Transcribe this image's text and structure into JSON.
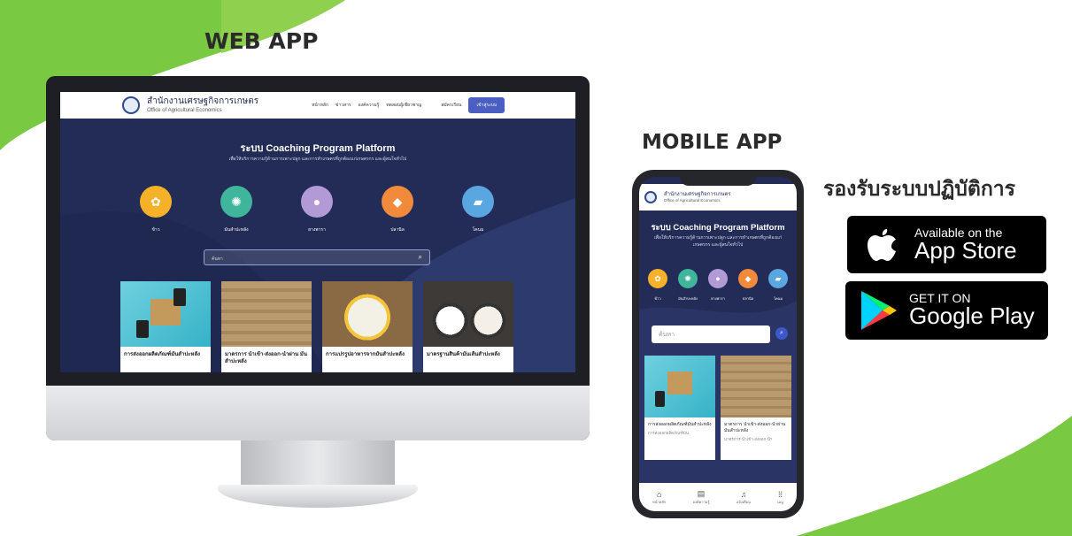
{
  "headings": {
    "web_app": "WEB APP",
    "mobile_app": "MOBILE APP",
    "supports": "รองรับระบบปฏิบัติการ"
  },
  "site": {
    "org_th": "สำนักงานเศรษฐกิจการเกษตร",
    "org_en": "Office of Agricultural Economics",
    "nav": [
      "หน้าหลัก",
      "ข่าวสาร",
      "องค์ความรู้",
      "ทดสอบผู้เชี่ยวชาญ"
    ],
    "register": "สมัครเรียน",
    "login": "เข้าสู่ระบบ",
    "title": "ระบบ Coaching Program Platform",
    "subtitle": "เพื่อให้บริการความรู้ด้านการเพาะปลูก และการทำเกษตรที่ถูกต้องแก่เกษตรกร และผู้สนใจทั่วไป",
    "categories": [
      "ข้าว",
      "มันสำปะหลัง",
      "ยางพารา",
      "ปลานิล",
      "โคนม"
    ],
    "search_placeholder": "ค้นหา",
    "cards": [
      "การส่งออกผลิตภัณฑ์มันสำปะหลัง",
      "มาตรการ นำเข้า-ส่งออก-นำผ่าน มันสำปะหลัง",
      "การแปรรูปอาหารจากมันสำปะหลัง",
      "มาตรฐานสินค้ามันเส้นสำปะหลัง"
    ]
  },
  "mobile": {
    "org_th": "สำนักงานเศรษฐกิจการเกษตร",
    "org_en": "Office of Agricultural Economics",
    "title": "ระบบ Coaching Program Platform",
    "subtitle": "เพื่อให้บริการความรู้ด้านการเพาะปลูก และการทำเกษตรที่ถูกต้องแก่เกษตรกร และผู้สนใจทั่วไป",
    "categories": [
      "ข้าว",
      "มันสำปะหลัง",
      "ยางพารา",
      "ปลานิล",
      "โคนม"
    ],
    "search_placeholder": "ค้นหา",
    "cards": [
      {
        "title": "การส่งออกผลิตภัณฑ์มันสำปะหลัง",
        "sub": "การส่งออกผลิตภัณฑ์มัน"
      },
      {
        "title": "มาตรการ นำเข้า-ส่งออก-นำผ่าน มันสำปะหลัง",
        "sub": "มาตรการ-นำเข้า-ส่งออก-นำ"
      }
    ],
    "tabs": [
      "หน้าหลัก",
      "องค์ความรู้",
      "แจ้งเตือน",
      "เมนู"
    ]
  },
  "stores": {
    "apple_small": "Available on the",
    "apple_big": "App Store",
    "google_small": "GET IT ON",
    "google_big": "Google Play"
  },
  "colors": {
    "green": "#7ac943",
    "navy": "#232c57",
    "cat_yellow": "#f6b12a",
    "cat_teal": "#3fb69b",
    "cat_purple": "#b29ad6",
    "cat_orange": "#f28a3c",
    "cat_blue": "#5aa6e0"
  }
}
